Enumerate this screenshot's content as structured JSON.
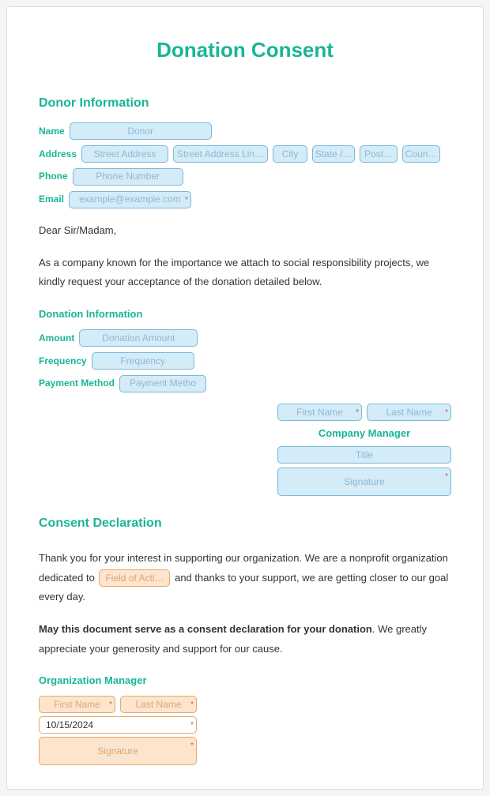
{
  "title": "Donation Consent",
  "sections": {
    "donor_info": "Donor Information",
    "donation_info": "Donation Information",
    "consent": "Consent Declaration",
    "org_mgr": "Organization Manager"
  },
  "labels": {
    "name": "Name",
    "address": "Address",
    "phone": "Phone",
    "email": "Email",
    "amount": "Amount",
    "frequency": "Frequency",
    "payment": "Payment Method",
    "company_mgr": "Company Manager"
  },
  "placeholders": {
    "donor": "Donor",
    "street": "Street Address",
    "street2": "Street Address Lin…",
    "city": "City",
    "state": "State /…",
    "postal": "Post…",
    "country": "Coun…",
    "phone": "Phone Number",
    "email": "example@example.com",
    "amount": "Donation Amount",
    "frequency": "Frequency",
    "payment": "Payment Metho",
    "first": "First Name",
    "last": "Last Name",
    "title_f": "Title",
    "signature": "Signature",
    "field_activity": "Field of Acti…"
  },
  "body": {
    "greeting": "Dear Sir/Madam,",
    "intro": "As a company known for the importance we attach to social responsibility projects, we kindly request your acceptance of the donation detailed below.",
    "consent_p1a": "Thank you for your interest in supporting our organization. We are a nonprofit organization dedicated to",
    "consent_p1b": "and thanks to your support, we are getting closer to our goal every day.",
    "consent_p2a": "May this document serve as a consent declaration for your donation",
    "consent_p2b": ". We greatly appreciate your generosity and support for our cause."
  },
  "values": {
    "date": "10/15/2024"
  }
}
